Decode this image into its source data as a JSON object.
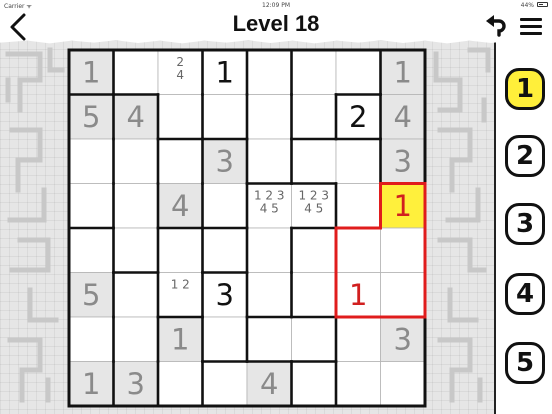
{
  "status_bar": {
    "carrier": "Carrier ᯤ",
    "time": "12:09 PM",
    "battery": "44%"
  },
  "header": {
    "title": "Level 18"
  },
  "colors": {
    "given_bg": "#e6e6e6",
    "selected_bg": "#fff03c",
    "error": "#d11f1f",
    "highlight_border": "#e01c1c",
    "accent_yellow": "#ffef3a"
  },
  "board": {
    "size": 8,
    "max_value": 5,
    "cells": [
      [
        {
          "v": "1",
          "given": true
        },
        {},
        {
          "notes": "2\n4"
        },
        {
          "v": "1"
        },
        {},
        {},
        {},
        {
          "v": "1",
          "given": true
        }
      ],
      [
        {
          "v": "5",
          "given": true
        },
        {
          "v": "4",
          "given": true
        },
        {},
        {},
        {},
        {},
        {
          "v": "2"
        },
        {
          "v": "4",
          "given": true
        }
      ],
      [
        {},
        {},
        {},
        {
          "v": "3",
          "given": true
        },
        {},
        {},
        {},
        {
          "v": "3",
          "given": true
        }
      ],
      [
        {},
        {},
        {
          "v": "4",
          "given": true
        },
        {},
        {
          "notes": "1 2 3\n4 5"
        },
        {
          "notes": "1 2 3\n4 5"
        },
        {},
        {
          "v": "1",
          "selected": true,
          "error": true
        }
      ],
      [
        {},
        {},
        {},
        {},
        {},
        {},
        {},
        {}
      ],
      [
        {
          "v": "5",
          "given": true
        },
        {},
        {
          "notes": "1 2"
        },
        {
          "v": "3"
        },
        {},
        {},
        {
          "v": "1",
          "error": true
        },
        {}
      ],
      [
        {},
        {},
        {
          "v": "1",
          "given": true
        },
        {},
        {},
        {},
        {},
        {
          "v": "3",
          "given": true
        }
      ],
      [
        {
          "v": "1",
          "given": true
        },
        {
          "v": "3",
          "given": true
        },
        {},
        {},
        {
          "v": "4",
          "given": true
        },
        {},
        {},
        {}
      ]
    ],
    "regions": [
      [
        0,
        1,
        1,
        2,
        3,
        4,
        4,
        5
      ],
      [
        6,
        7,
        1,
        2,
        3,
        4,
        8,
        5
      ],
      [
        6,
        7,
        9,
        10,
        3,
        11,
        11,
        5
      ],
      [
        6,
        7,
        9,
        10,
        12,
        12,
        11,
        13
      ],
      [
        14,
        7,
        15,
        16,
        12,
        17,
        13,
        13
      ],
      [
        14,
        18,
        15,
        19,
        12,
        17,
        13,
        13
      ],
      [
        14,
        18,
        20,
        19,
        21,
        21,
        22,
        22
      ],
      [
        14,
        18,
        20,
        23,
        23,
        24,
        22,
        22
      ]
    ],
    "highlight_region": 13
  },
  "number_pad": {
    "buttons": [
      "1",
      "2",
      "3",
      "4",
      "5"
    ],
    "active": "1"
  },
  "icons": {
    "back": "chevron-left-icon",
    "undo": "undo-icon",
    "menu": "hamburger-menu-icon"
  }
}
